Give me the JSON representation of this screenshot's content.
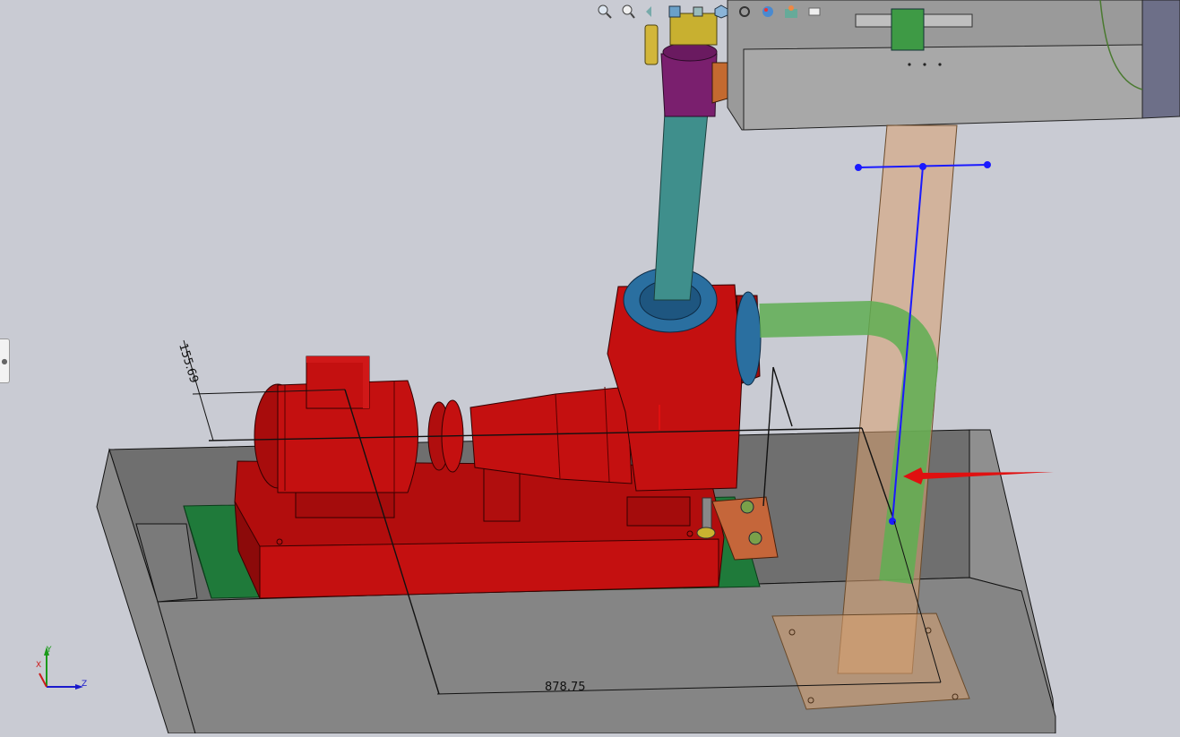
{
  "toolbar": {
    "buttons": [
      {
        "name": "zoom-to-fit-button",
        "icon": "zoom-to-fit-icon"
      },
      {
        "name": "zoom-to-area-button",
        "icon": "zoom-to-area-icon"
      },
      {
        "name": "previous-view-button",
        "icon": "previous-view-icon"
      },
      {
        "name": "section-view-button",
        "icon": "section-view-icon"
      },
      {
        "name": "view-orientation-button",
        "icon": "view-orientation-icon"
      },
      {
        "name": "display-style-button",
        "icon": "display-style-icon"
      },
      {
        "name": "hide-show-items-button",
        "icon": "hide-show-items-icon"
      },
      {
        "name": "edit-appearance-button",
        "icon": "edit-appearance-icon"
      },
      {
        "name": "apply-scene-button",
        "icon": "apply-scene-icon"
      },
      {
        "name": "view-settings-button",
        "icon": "view-settings-icon"
      }
    ]
  },
  "dimensions": {
    "vertical_offset": "155.69",
    "horizontal_length": "878.75"
  },
  "triad": {
    "y": "Y",
    "x": "X",
    "z": "Z"
  },
  "colors": {
    "background": "#c9cbd3",
    "pump_red": "#c41010",
    "base_green": "#1f7a3a",
    "pipe_green": "#5fae52",
    "pipe_teal": "#3f8f8c",
    "flange_blue": "#2a6fa0",
    "support_orange": "#d9a070",
    "sketch_blue": "#1a1aff",
    "arrow_red": "#e01010",
    "tray_grey": "#7e7e7e"
  }
}
